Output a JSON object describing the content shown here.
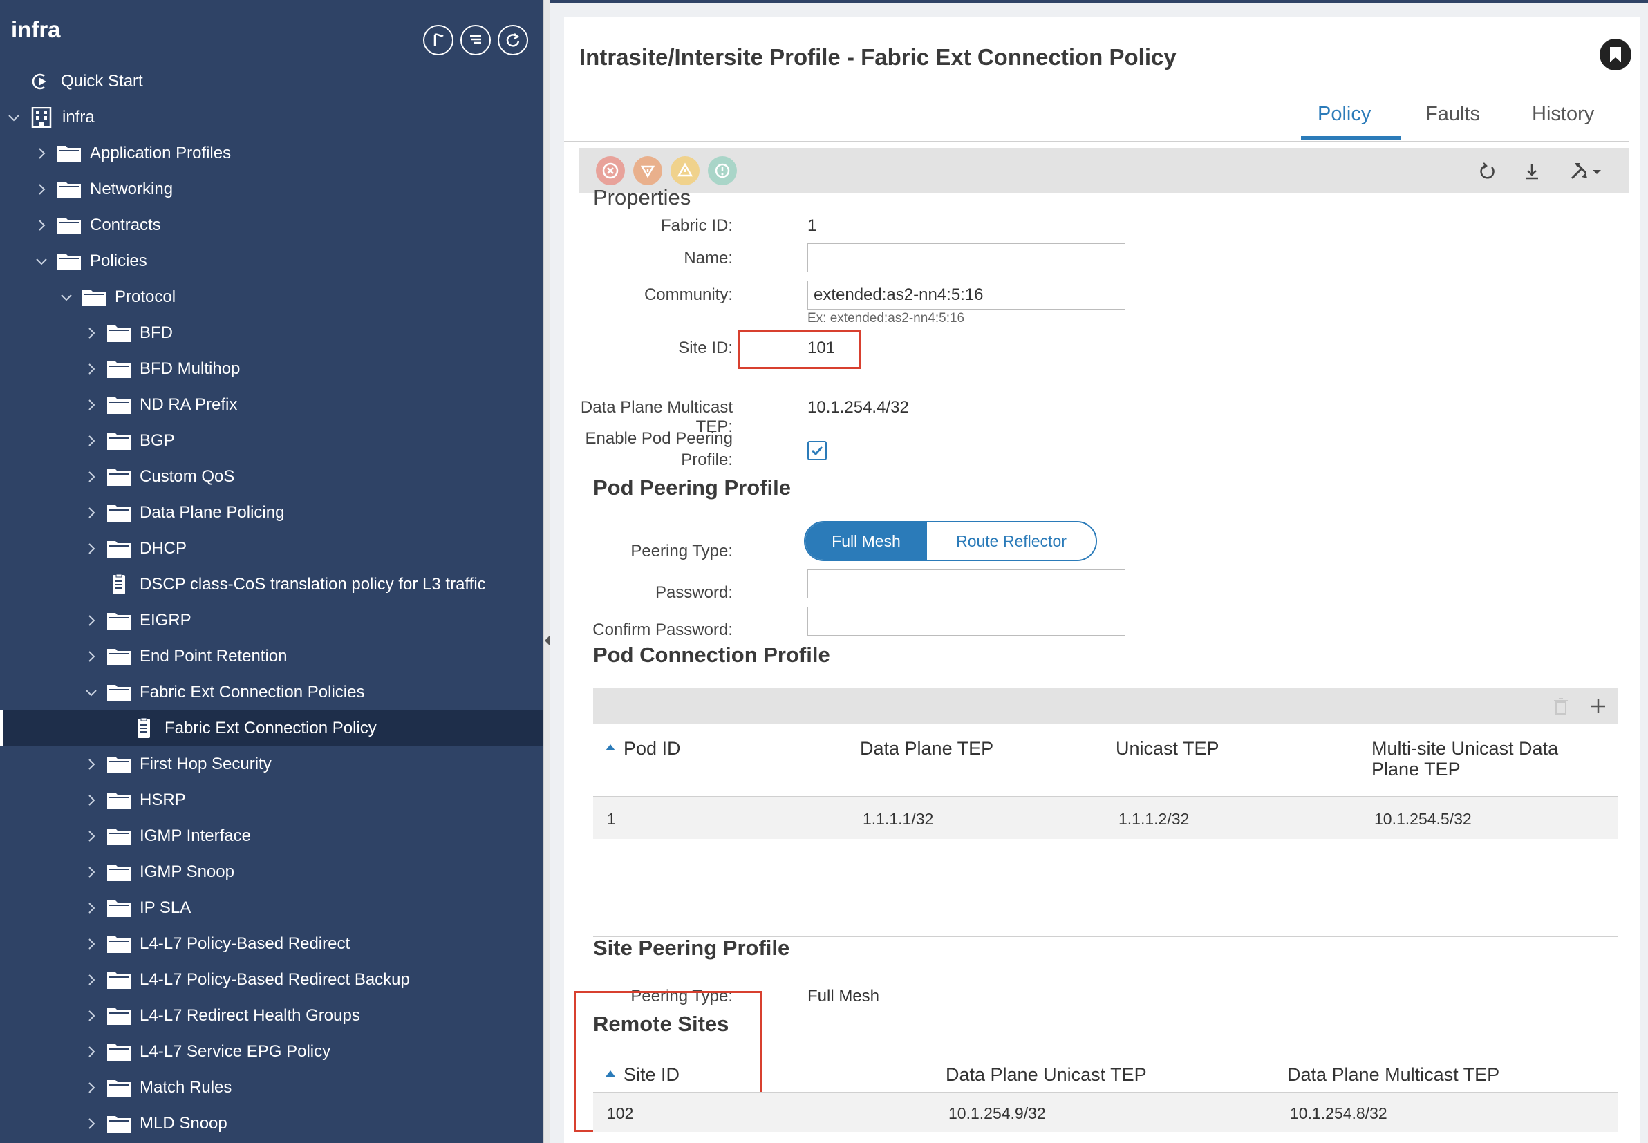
{
  "sidebar": {
    "title": "infra",
    "items": [
      {
        "label": "Quick Start"
      },
      {
        "label": "infra"
      },
      {
        "label": "Application Profiles"
      },
      {
        "label": "Networking"
      },
      {
        "label": "Contracts"
      },
      {
        "label": "Policies"
      },
      {
        "label": "Protocol"
      },
      {
        "label": "BFD"
      },
      {
        "label": "BFD Multihop"
      },
      {
        "label": "ND RA Prefix"
      },
      {
        "label": "BGP"
      },
      {
        "label": "Custom QoS"
      },
      {
        "label": "Data Plane Policing"
      },
      {
        "label": "DHCP"
      },
      {
        "label": "DSCP class-CoS translation policy for L3 traffic"
      },
      {
        "label": "EIGRP"
      },
      {
        "label": "End Point Retention"
      },
      {
        "label": "Fabric Ext Connection Policies"
      },
      {
        "label": "Fabric Ext Connection Policy"
      },
      {
        "label": "First Hop Security"
      },
      {
        "label": "HSRP"
      },
      {
        "label": "IGMP Interface"
      },
      {
        "label": "IGMP Snoop"
      },
      {
        "label": "IP SLA"
      },
      {
        "label": "L4-L7 Policy-Based Redirect"
      },
      {
        "label": "L4-L7 Policy-Based Redirect Backup"
      },
      {
        "label": "L4-L7 Redirect Health Groups"
      },
      {
        "label": "L4-L7 Service EPG Policy"
      },
      {
        "label": "Match Rules"
      },
      {
        "label": "MLD Snoop"
      }
    ]
  },
  "header": {
    "title": "Intrasite/Intersite Profile - Fabric Ext Connection Policy"
  },
  "tabs": [
    {
      "label": "Policy",
      "active": true
    },
    {
      "label": "Faults",
      "active": false
    },
    {
      "label": "History",
      "active": false
    }
  ],
  "properties": {
    "heading": "Properties",
    "fabric_id_label": "Fabric ID:",
    "fabric_id": "1",
    "name_label": "Name:",
    "name_value": "",
    "community_label": "Community:",
    "community_value": "extended:as2-nn4:5:16",
    "community_hint": "Ex: extended:as2-nn4:5:16",
    "site_id_label": "Site ID:",
    "site_id": "101",
    "multicast_tep_label": "Data Plane Multicast TEP:",
    "multicast_tep": "10.1.254.4/32",
    "enable_pod_peering_label_1": "Enable Pod Peering",
    "enable_pod_peering_label_2": "Profile:",
    "enable_pod_peering_checked": true
  },
  "pod_peering": {
    "heading": "Pod Peering Profile",
    "type_label": "Peering Type:",
    "option_full_mesh": "Full Mesh",
    "option_route_reflector": "Route Reflector",
    "selected": "Full Mesh",
    "password_label": "Password:",
    "confirm_password_label": "Confirm Password:"
  },
  "pod_connection": {
    "heading": "Pod Connection Profile",
    "columns": [
      "Pod ID",
      "Data Plane TEP",
      "Unicast TEP",
      "Multi-site Unicast Data",
      "Plane TEP"
    ],
    "rows": [
      {
        "pod_id": "1",
        "data_plane_tep": "1.1.1.1/32",
        "unicast_tep": "1.1.1.2/32",
        "multisite_tep": "10.1.254.5/32"
      }
    ]
  },
  "site_peering": {
    "heading": "Site Peering Profile",
    "type_label": "Peering Type:",
    "type_value": "Full Mesh"
  },
  "remote_sites": {
    "heading": "Remote Sites",
    "columns": [
      "Site ID",
      "Data Plane Unicast TEP",
      "Data Plane Multicast TEP"
    ],
    "rows": [
      {
        "site_id": "102",
        "unicast_tep": "10.1.254.9/32",
        "multicast_tep": "10.1.254.8/32"
      }
    ]
  },
  "colors": {
    "sidebar_bg": "#2f4366",
    "accent": "#2b7bb9",
    "highlight_red": "#d8402f",
    "fault_critical": "#e8a29a",
    "fault_major": "#e9b08c",
    "fault_minor": "#f0d28c",
    "fault_warning": "#a9d5c8"
  }
}
